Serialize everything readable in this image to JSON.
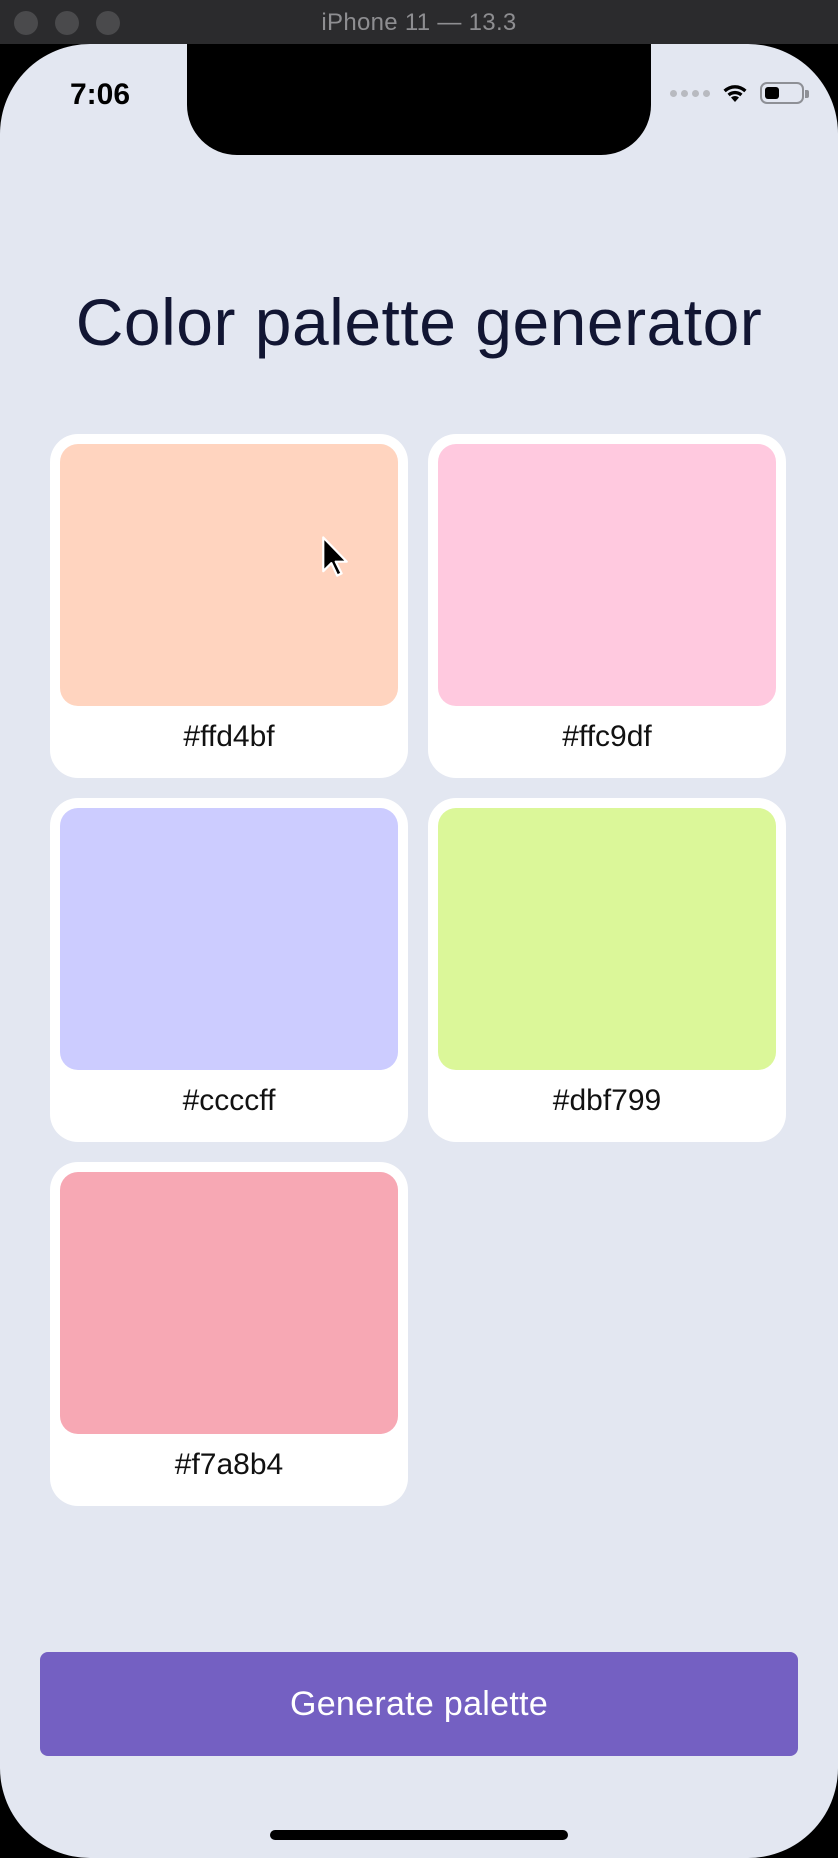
{
  "window": {
    "title": "iPhone 11 — 13.3"
  },
  "status_bar": {
    "time": "7:06",
    "battery_level": 0.4,
    "icons": [
      "cellular-icon",
      "wifi-icon",
      "battery-icon"
    ]
  },
  "app": {
    "title": "Color palette generator",
    "palette": [
      {
        "hex": "#ffd4bf",
        "color": "#ffd4bf"
      },
      {
        "hex": "#ffc9df",
        "color": "#ffc9df"
      },
      {
        "hex": "#ccccff",
        "color": "#ccccff"
      },
      {
        "hex": "#dbf799",
        "color": "#dbf799"
      },
      {
        "hex": "#f7a8b4",
        "color": "#f7a8b4"
      }
    ],
    "generate_label": "Generate palette"
  },
  "colors": {
    "background": "#e3e7f1",
    "button": "#7460c2",
    "title_text": "#121633"
  }
}
